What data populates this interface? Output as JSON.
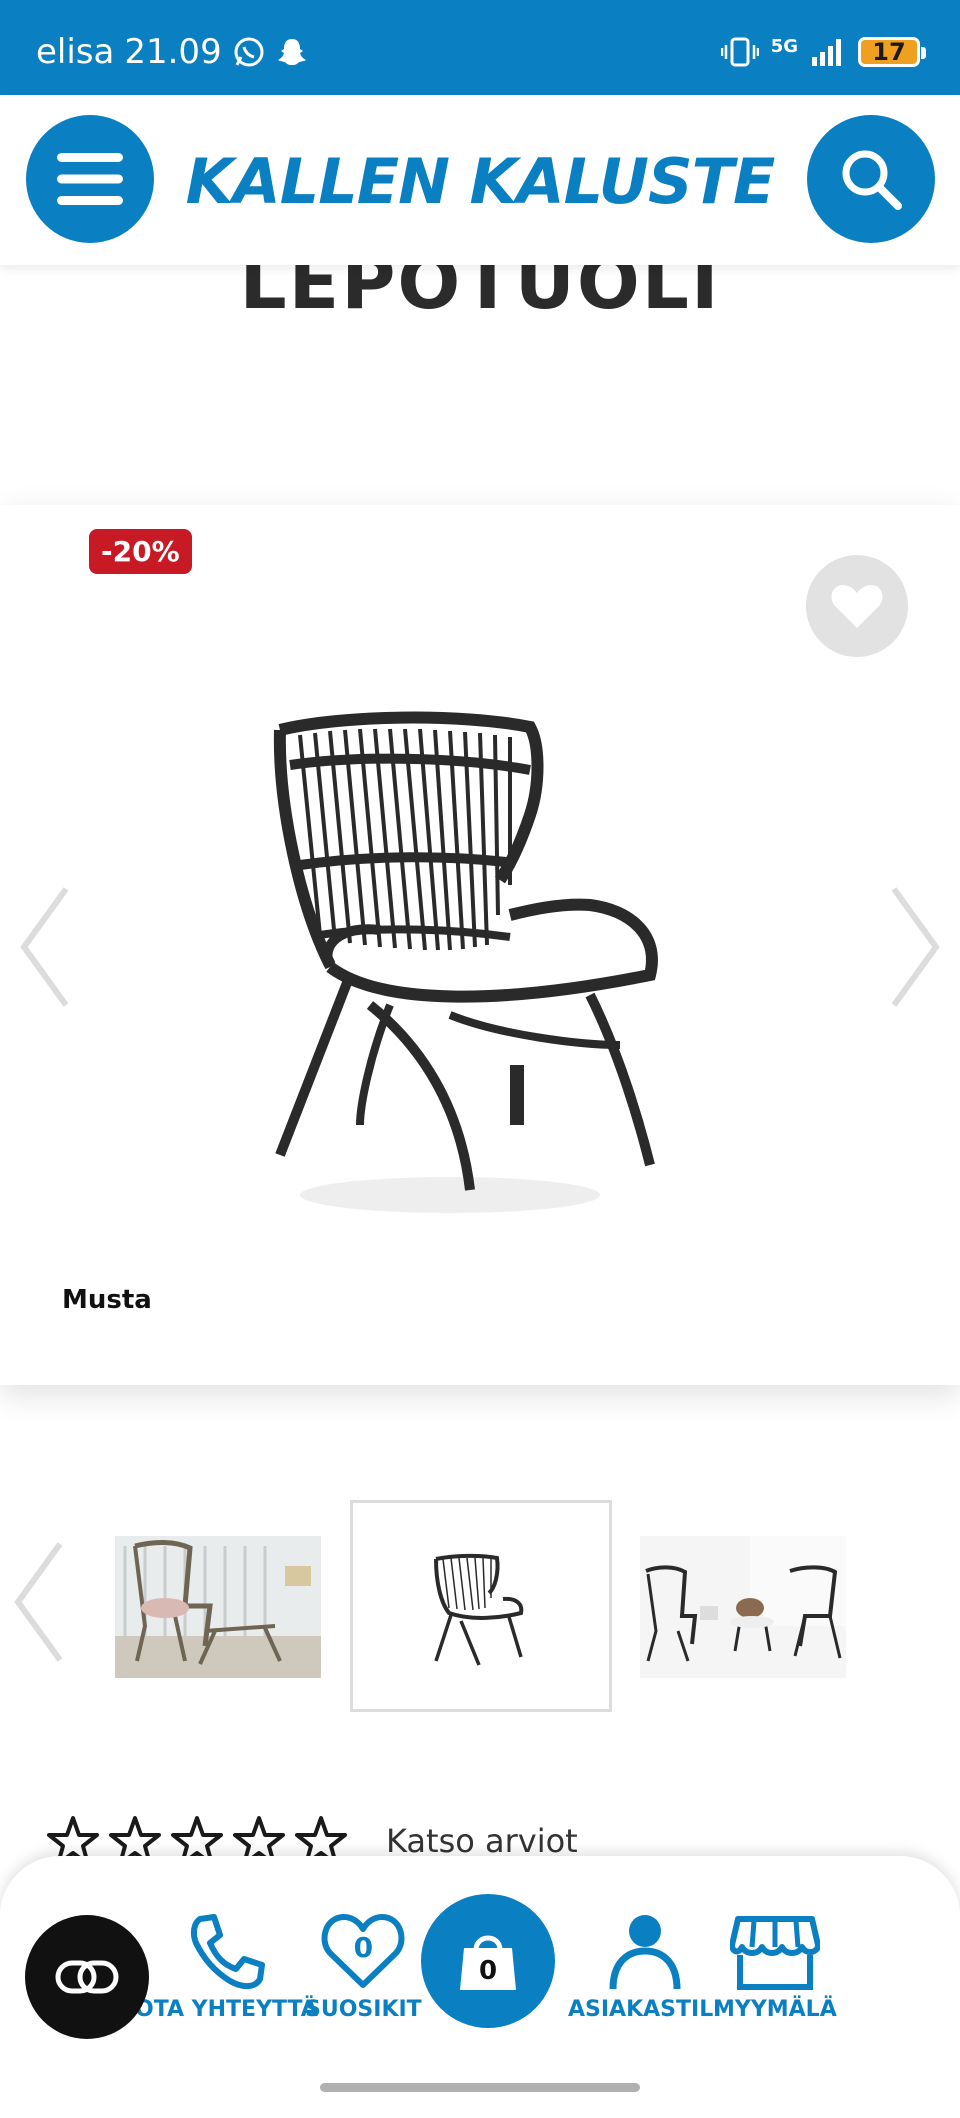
{
  "status_bar": {
    "carrier": "elisa",
    "time": "21.09",
    "network": "5G",
    "battery": "17"
  },
  "header": {
    "logo": "KALLEN KALUSTE",
    "menu_icon": "hamburger-icon",
    "search_icon": "search-icon"
  },
  "product": {
    "title": "LEPOTUOLI",
    "discount_badge": "-20%",
    "color_label": "Musta",
    "rating_link": "Katso arviot"
  },
  "bottom_nav": {
    "contact_label": "OTA YHTEYTTÄ",
    "favorites_label": "SUOSIKIT",
    "favorites_count": "0",
    "cart_count": "0",
    "account_label": "ASIAKASTILI",
    "store_label": "MYYMÄLÄ"
  },
  "colors": {
    "brand": "#0a7fc1",
    "badge": "#c71a24"
  }
}
